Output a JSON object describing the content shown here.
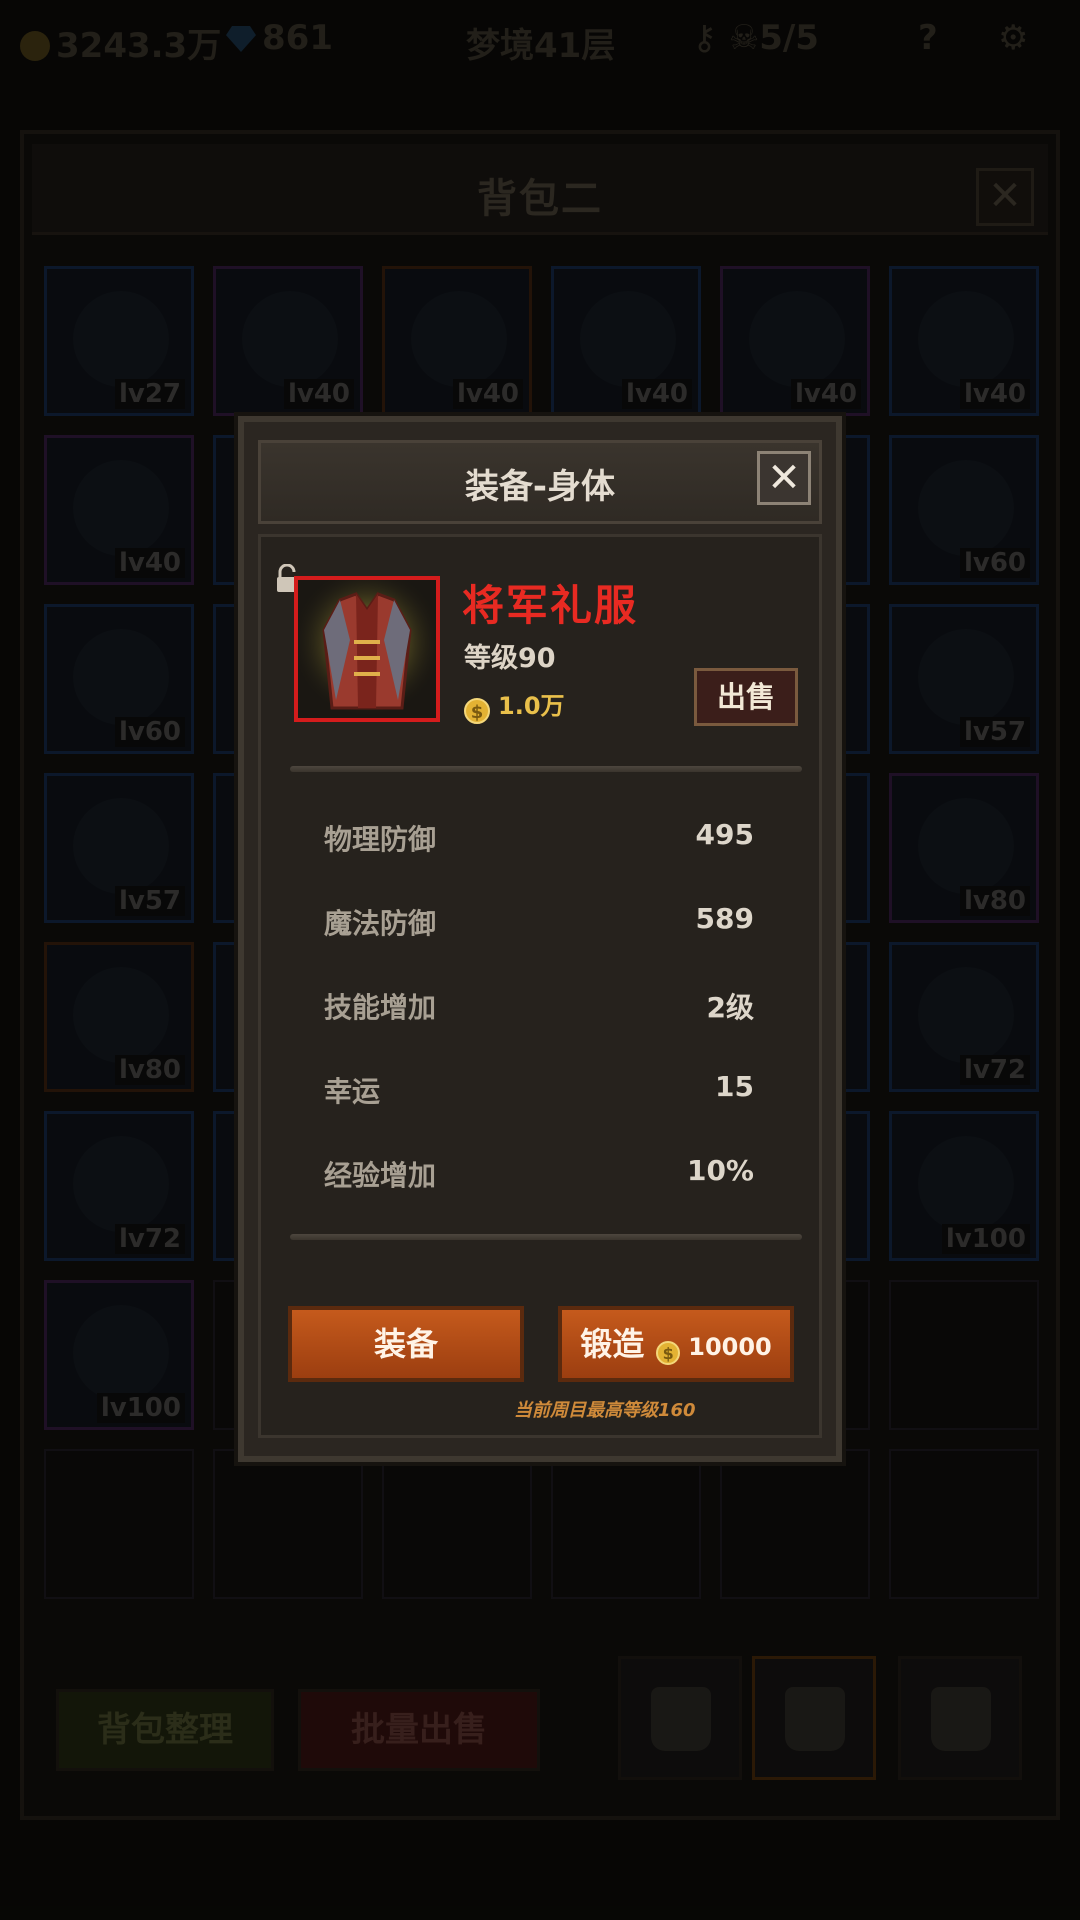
{
  "topbar": {
    "gold": "3243.3万",
    "gems": "861",
    "stage": "梦境41层",
    "skull_count": "5/5",
    "help": "?"
  },
  "bag": {
    "title": "背包二",
    "close": "✕",
    "sort_label": "背包整理",
    "bulk_sell_label": "批量出售",
    "items": [
      {
        "lv": "lv27",
        "frame": "blue"
      },
      {
        "lv": "lv40",
        "frame": "purple"
      },
      {
        "lv": "lv40",
        "frame": "orange"
      },
      {
        "lv": "lv40",
        "frame": "blue"
      },
      {
        "lv": "lv40",
        "frame": "purple"
      },
      {
        "lv": "lv40",
        "frame": "blue"
      },
      {
        "lv": "lv40",
        "frame": "purple"
      },
      {
        "lv": "lv60",
        "frame": "blue"
      },
      {
        "lv": "lv60",
        "frame": "blue"
      },
      {
        "lv": "lv57",
        "frame": "blue"
      },
      {
        "lv": "lv57",
        "frame": "blue"
      },
      {
        "lv": "lv80",
        "frame": "purple"
      },
      {
        "lv": "lv80",
        "frame": "orange"
      },
      {
        "lv": "lv72",
        "frame": "blue"
      },
      {
        "lv": "lv72",
        "frame": "blue"
      },
      {
        "lv": "lv100",
        "frame": "blue"
      },
      {
        "lv": "lv100",
        "frame": "purple"
      }
    ]
  },
  "dialog": {
    "title": "装备-身体",
    "close": "✕",
    "item_name": "将军礼服",
    "item_level": "等级90",
    "item_price": "1.0万",
    "coin_symbol": "$",
    "sell_label": "出售",
    "stats": [
      {
        "label": "物理防御",
        "value": "495"
      },
      {
        "label": "魔法防御",
        "value": "589"
      },
      {
        "label": "技能增加",
        "value": "2级"
      },
      {
        "label": "幸运",
        "value": "15"
      },
      {
        "label": "经验增加",
        "value": "10%"
      }
    ],
    "equip_label": "装备",
    "forge_label": "锻造",
    "forge_cost": "10000",
    "footnote": "当前周目最高等级160"
  },
  "colors": {
    "item_name": "#e82a22",
    "button_orange": "#c55a1c",
    "gold": "#e9c04b"
  }
}
